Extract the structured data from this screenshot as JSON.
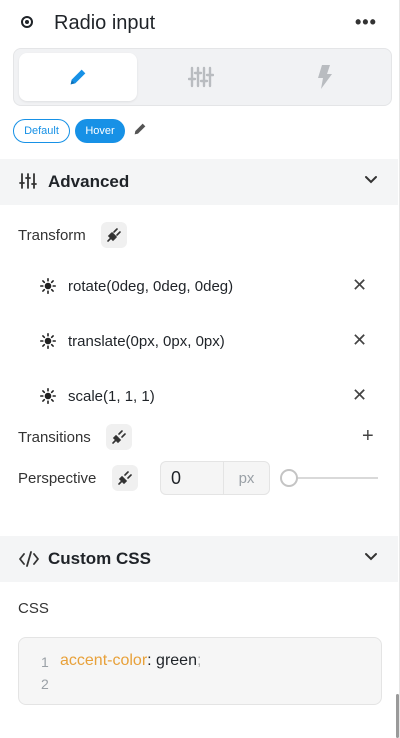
{
  "header": {
    "title": "Radio input",
    "more_label": "•••"
  },
  "tabs": [
    {
      "name": "style",
      "icon": "pencil-icon",
      "active": true
    },
    {
      "name": "settings",
      "icon": "sliders-icon",
      "active": false
    },
    {
      "name": "interactions",
      "icon": "lightning-icon",
      "active": false
    }
  ],
  "states": {
    "default_label": "Default",
    "hover_label": "Hover",
    "active": "Hover"
  },
  "advanced": {
    "title": "Advanced",
    "transform_label": "Transform",
    "transforms": [
      {
        "value": "rotate(0deg, 0deg, 0deg)"
      },
      {
        "value": "translate(0px, 0px, 0px)"
      },
      {
        "value": "scale(1, 1, 1)"
      }
    ],
    "transitions_label": "Transitions",
    "add_label": "+",
    "perspective_label": "Perspective",
    "perspective_value": "0",
    "perspective_unit": "px",
    "perspective_slider_fraction": 0
  },
  "custom_css": {
    "title": "Custom CSS",
    "css_label": "CSS",
    "lines": [
      {
        "number": "1",
        "property": "accent-color",
        "colon": ":",
        "value": " green",
        "semicolon": ";"
      },
      {
        "number": "2"
      }
    ]
  },
  "colors": {
    "accent": "#1791e6",
    "css_property": "#e8a13a"
  }
}
